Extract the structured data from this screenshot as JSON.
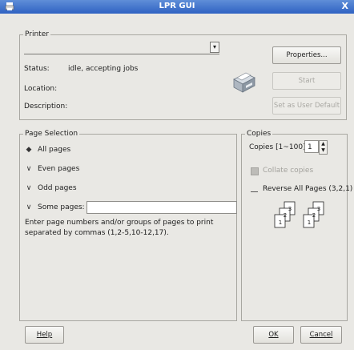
{
  "window": {
    "title": "LPR GUI",
    "close_glyph": "X"
  },
  "printer": {
    "group_label": "Printer",
    "status_label": "Status:",
    "status_value": "idle, accepting jobs",
    "location_label": "Location:",
    "location_value": "",
    "description_label": "Description:",
    "description_value": "",
    "buttons": {
      "properties": "Properties...",
      "start": "Start",
      "set_default": "Set as User Default"
    }
  },
  "page_selection": {
    "group_label": "Page Selection",
    "options": [
      "All pages",
      "Even pages",
      "Odd pages",
      "Some pages:"
    ],
    "selected_index": 0,
    "some_pages_value": "",
    "hint": "Enter page numbers and/or groups of pages to print separated by commas (1,2-5,10-12,17)."
  },
  "copies": {
    "group_label": "Copies",
    "copies_label": "Copies [1~100]:",
    "copies_value": "1",
    "collate_label": "Collate copies",
    "collate_enabled": false,
    "reverse_label": "Reverse All Pages (3,2,1)",
    "stack1": [
      "3",
      "2",
      "1"
    ],
    "stack2": [
      "3",
      "2",
      "1"
    ]
  },
  "footer": {
    "help": "Help",
    "ok": "OK",
    "cancel": "Cancel"
  }
}
